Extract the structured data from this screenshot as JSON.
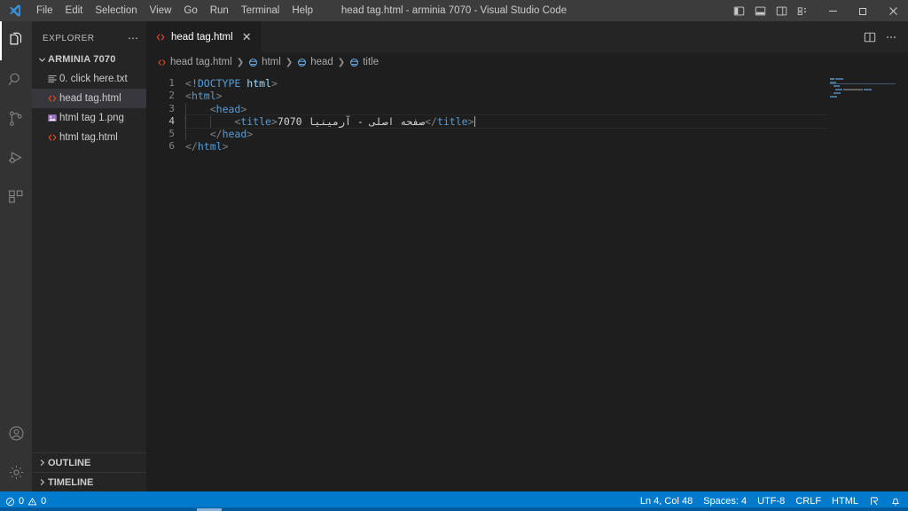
{
  "window": {
    "title": "head tag.html - arminia 7070 - Visual Studio Code",
    "logo_icon": "vscode-logo",
    "minimize_icon": "minimize-icon",
    "maximize_icon": "maximize-icon",
    "close_icon": "close-icon",
    "layout_buttons": [
      {
        "name": "toggle-primary-sidebar",
        "icon": "layout-sidebar-left-icon"
      },
      {
        "name": "toggle-panel",
        "icon": "layout-panel-icon"
      },
      {
        "name": "toggle-secondary-sidebar",
        "icon": "layout-sidebar-right-icon"
      },
      {
        "name": "customize-layout",
        "icon": "layout-customize-icon"
      }
    ]
  },
  "menubar": [
    {
      "label": "File"
    },
    {
      "label": "Edit"
    },
    {
      "label": "Selection"
    },
    {
      "label": "View"
    },
    {
      "label": "Go"
    },
    {
      "label": "Run"
    },
    {
      "label": "Terminal"
    },
    {
      "label": "Help"
    }
  ],
  "activitybar": {
    "top": [
      {
        "name": "explorer",
        "icon": "files-icon",
        "active": true
      },
      {
        "name": "search",
        "icon": "search-icon",
        "active": false
      },
      {
        "name": "source-control",
        "icon": "source-control-icon",
        "active": false
      },
      {
        "name": "run-and-debug",
        "icon": "run-debug-icon",
        "active": false
      },
      {
        "name": "extensions",
        "icon": "extensions-icon",
        "active": false
      }
    ],
    "bottom": [
      {
        "name": "accounts",
        "icon": "account-icon"
      },
      {
        "name": "manage-settings",
        "icon": "gear-icon"
      }
    ]
  },
  "sidebar": {
    "header": "EXPLORER",
    "more_actions_icon": "ellipsis-icon",
    "folder": {
      "label": "ARMINIA 7070",
      "expanded": true,
      "chevron_icon": "chevron-down-icon"
    },
    "files": [
      {
        "name": "0. click here.txt",
        "icon": "text-file-icon",
        "selected": false
      },
      {
        "name": "head tag.html",
        "icon": "html-file-icon",
        "selected": true
      },
      {
        "name": "html tag 1.png",
        "icon": "image-file-icon",
        "selected": false
      },
      {
        "name": "html tag.html",
        "icon": "html-file-icon",
        "selected": false
      }
    ],
    "panels": [
      {
        "label": "OUTLINE",
        "chevron_icon": "chevron-right-icon"
      },
      {
        "label": "TIMELINE",
        "chevron_icon": "chevron-right-icon"
      }
    ]
  },
  "editor": {
    "tab": {
      "label": "head tag.html",
      "icon": "html-file-icon",
      "close_icon": "close-icon",
      "active": true
    },
    "tab_actions": [
      {
        "name": "split-editor-right",
        "icon": "split-editor-icon"
      },
      {
        "name": "more-editor-actions",
        "icon": "ellipsis-icon"
      }
    ],
    "breadcrumbs": [
      {
        "label": "head tag.html",
        "icon": "html-file-icon"
      },
      {
        "label": "html",
        "icon": "symbol-field-icon"
      },
      {
        "label": "head",
        "icon": "symbol-field-icon"
      },
      {
        "label": "title",
        "icon": "symbol-field-icon"
      }
    ],
    "line_numbers": [
      "1",
      "2",
      "3",
      "4",
      "5",
      "6"
    ],
    "active_line": 4,
    "code_lines": [
      {
        "number": "1",
        "indent": 0,
        "tokens": [
          {
            "t": "<",
            "c": "punct"
          },
          {
            "t": "!DOCTYPE",
            "c": "dtd"
          },
          {
            "t": " ",
            "c": "text"
          },
          {
            "t": "html",
            "c": "name"
          },
          {
            "t": ">",
            "c": "punct"
          }
        ]
      },
      {
        "number": "2",
        "indent": 0,
        "tokens": [
          {
            "t": "<",
            "c": "punct"
          },
          {
            "t": "html",
            "c": "tag"
          },
          {
            "t": ">",
            "c": "punct"
          }
        ]
      },
      {
        "number": "3",
        "indent": 1,
        "tokens": [
          {
            "t": "    ",
            "c": "text"
          },
          {
            "t": "<",
            "c": "punct"
          },
          {
            "t": "head",
            "c": "tag"
          },
          {
            "t": ">",
            "c": "punct"
          }
        ]
      },
      {
        "number": "4",
        "indent": 2,
        "tokens": [
          {
            "t": "        ",
            "c": "text"
          },
          {
            "t": "<",
            "c": "punct"
          },
          {
            "t": "title",
            "c": "tag"
          },
          {
            "t": ">",
            "c": "punct"
          },
          {
            "t": "صفحه اصلی - آرمینیا 7070",
            "c": "text"
          },
          {
            "t": "</",
            "c": "punct"
          },
          {
            "t": "title",
            "c": "tag"
          },
          {
            "t": ">",
            "c": "punct"
          }
        ]
      },
      {
        "number": "5",
        "indent": 1,
        "tokens": [
          {
            "t": "    ",
            "c": "text"
          },
          {
            "t": "</",
            "c": "punct"
          },
          {
            "t": "head",
            "c": "tag"
          },
          {
            "t": ">",
            "c": "punct"
          }
        ]
      },
      {
        "number": "6",
        "indent": 0,
        "tokens": [
          {
            "t": "</",
            "c": "punct"
          },
          {
            "t": "html",
            "c": "tag"
          },
          {
            "t": ">",
            "c": "punct"
          }
        ]
      }
    ]
  },
  "statusbar": {
    "errors": "0",
    "warnings": "0",
    "error_icon": "error-circle-icon",
    "warning_icon": "warning-triangle-icon",
    "cursor_position": "Ln 4, Col 48",
    "indentation": "Spaces: 4",
    "encoding": "UTF-8",
    "eol": "CRLF",
    "language": "HTML",
    "feedback_icon": "feedback-icon",
    "bell_icon": "bell-icon"
  },
  "colors": {
    "accent": "#007acc",
    "titlebar_bg": "#3c3c3c",
    "sidebar_bg": "#252526",
    "editor_bg": "#1e1e1e",
    "activitybar_bg": "#333333",
    "tag_blue": "#569cd6",
    "attr_light_blue": "#9cdcfe",
    "punct_gray": "#808080",
    "html_icon": "#e44d26",
    "png_icon": "#a074c4",
    "selection_bg": "#37373d"
  }
}
